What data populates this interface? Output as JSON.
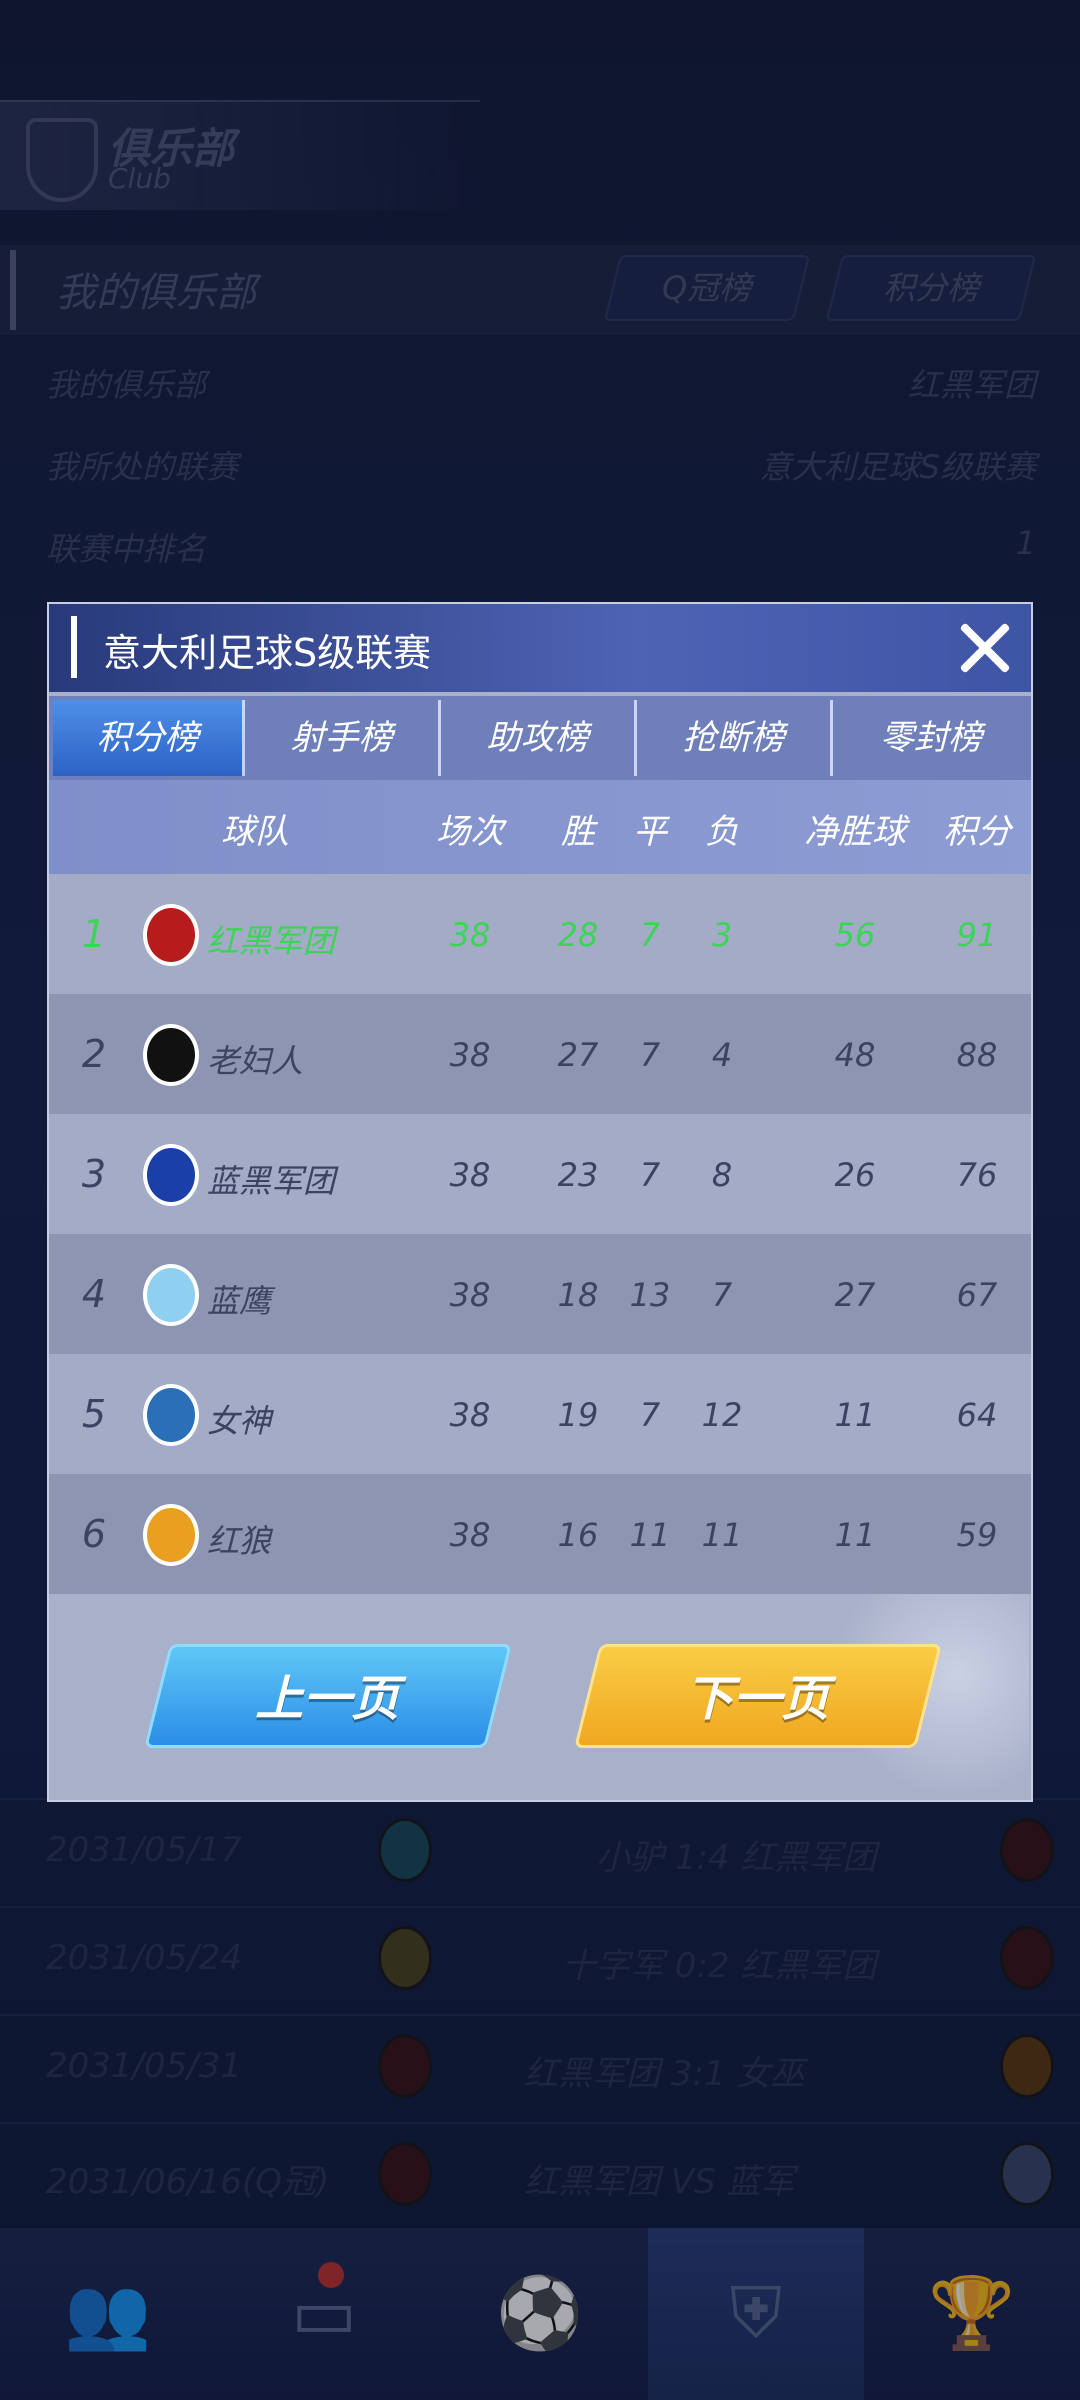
{
  "background": {
    "club_header": {
      "title": "俱乐部",
      "subtitle": "Club"
    },
    "section_title": "我的俱乐部",
    "tabs": [
      "Q冠榜",
      "积分榜"
    ],
    "info": [
      {
        "label": "我的俱乐部",
        "value": "红黑军团"
      },
      {
        "label": "我所处的联赛",
        "value": "意大利足球S级联赛"
      },
      {
        "label": "联赛中排名",
        "value": "1"
      }
    ],
    "matches": [
      {
        "date": "2031/05/17",
        "text": "小驴  1:4  红黑军团"
      },
      {
        "date": "2031/05/24",
        "text": "十字军  0:2  红黑军团"
      },
      {
        "date": "2031/05/31",
        "text": "红黑军团  3:1  女巫"
      },
      {
        "date": "2031/06/16(Q冠)",
        "text": "红黑军团  VS  蓝军"
      }
    ]
  },
  "modal": {
    "title": "意大利足球S级联赛",
    "tabs": [
      "积分榜",
      "射手榜",
      "助攻榜",
      "抢断榜",
      "零封榜"
    ],
    "columns": [
      "球队",
      "场次",
      "胜",
      "平",
      "负",
      "净胜球",
      "积分"
    ],
    "rows": [
      {
        "rank": "1",
        "team": "红黑军团",
        "played": "38",
        "w": "28",
        "d": "7",
        "l": "3",
        "gd": "56",
        "pts": "91",
        "crest_color": "#b71c1c"
      },
      {
        "rank": "2",
        "team": "老妇人",
        "played": "38",
        "w": "27",
        "d": "7",
        "l": "4",
        "gd": "48",
        "pts": "88",
        "crest_color": "#111111"
      },
      {
        "rank": "3",
        "team": "蓝黑军团",
        "played": "38",
        "w": "23",
        "d": "7",
        "l": "8",
        "gd": "26",
        "pts": "76",
        "crest_color": "#1a3fa8"
      },
      {
        "rank": "4",
        "team": "蓝鹰",
        "played": "38",
        "w": "18",
        "d": "13",
        "l": "7",
        "gd": "27",
        "pts": "67",
        "crest_color": "#8fd0f0"
      },
      {
        "rank": "5",
        "team": "女神",
        "played": "38",
        "w": "19",
        "d": "7",
        "l": "12",
        "gd": "11",
        "pts": "64",
        "crest_color": "#2b6fb8"
      },
      {
        "rank": "6",
        "team": "红狼",
        "played": "38",
        "w": "16",
        "d": "11",
        "l": "11",
        "gd": "11",
        "pts": "59",
        "crest_color": "#e9a020"
      }
    ],
    "prev_label": "上一页",
    "next_label": "下一页"
  },
  "colors": {
    "highlight": "#3cd456",
    "prev_button": "#2b8ee8",
    "next_button": "#f0a720"
  }
}
